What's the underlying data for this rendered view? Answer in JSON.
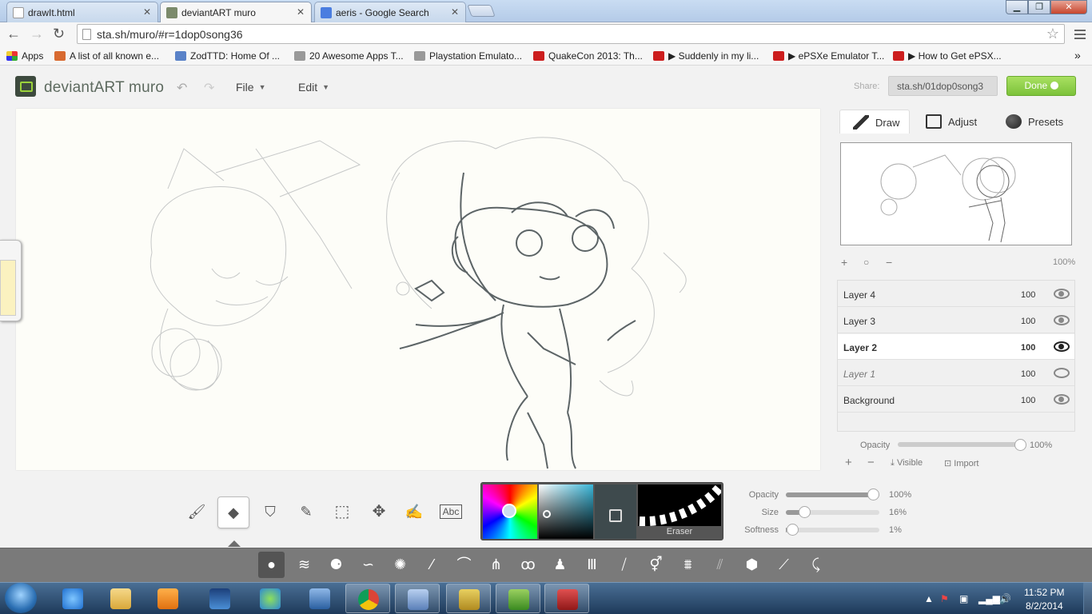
{
  "browser": {
    "tabs": [
      {
        "title": "drawIt.html",
        "close": "✕"
      },
      {
        "title": "deviantART muro",
        "close": "✕"
      },
      {
        "title": "aeris - Google Search",
        "close": "✕"
      }
    ],
    "url": "sta.sh/muro/#r=1dop0song36",
    "bookmarks": [
      {
        "label": "Apps"
      },
      {
        "label": "A list of all known e..."
      },
      {
        "label": "ZodTTD: Home Of ..."
      },
      {
        "label": "20 Awesome Apps T..."
      },
      {
        "label": "Playstation Emulato..."
      },
      {
        "label": "QuakeCon 2013: Th..."
      },
      {
        "label": "▶ Suddenly in my li..."
      },
      {
        "label": "▶ ePSXe Emulator T..."
      },
      {
        "label": "▶ How to Get ePSX..."
      }
    ],
    "more_bookmarks": "»"
  },
  "muro": {
    "logo": "deviantART muro",
    "menus": [
      {
        "label": "File"
      },
      {
        "label": "Edit"
      }
    ],
    "share_label": "Share:",
    "share_value": "sta.sh/01dop0song3",
    "done_label": "Done",
    "right_tabs": [
      {
        "label": "Draw"
      },
      {
        "label": "Adjust"
      },
      {
        "label": "Presets"
      }
    ],
    "zoom": "100%",
    "layers": [
      {
        "name": "Layer 4",
        "opacity": "100",
        "state": "visible"
      },
      {
        "name": "Layer 3",
        "opacity": "100",
        "state": "visible"
      },
      {
        "name": "Layer 2",
        "opacity": "100",
        "state": "active"
      },
      {
        "name": "Layer 1",
        "opacity": "100",
        "state": "hidden"
      },
      {
        "name": "Background",
        "opacity": "100",
        "state": "visible"
      }
    ],
    "layer_opacity_label": "Opacity",
    "layer_opacity_value": "100%",
    "layer_opacity_level": 1.0,
    "layer_actions": {
      "visible": "Visible",
      "import": "Import"
    },
    "brush_name": "Eraser",
    "tool_text_label": "Abc",
    "sliders": [
      {
        "label": "Opacity",
        "value": "100%",
        "level": 1.0
      },
      {
        "label": "Size",
        "value": "16%",
        "level": 0.16
      },
      {
        "label": "Softness",
        "value": "1%",
        "level": 0.01
      }
    ]
  },
  "taskbar": {
    "time": "11:52 PM",
    "date": "8/2/2014"
  },
  "colors": {
    "done_green": "#7cc23a",
    "swatch": "#3e4a4d",
    "canvas_bg": "#fdfdf8"
  }
}
